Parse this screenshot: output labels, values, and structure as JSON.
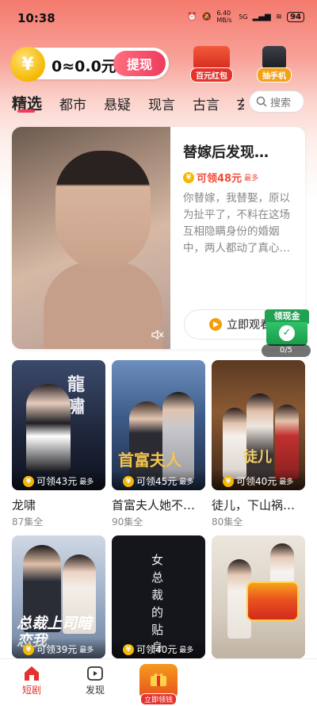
{
  "status": {
    "time": "10:38",
    "network": "6.40 MB/s",
    "signal": "5G",
    "battery": "94"
  },
  "wallet": {
    "coin_symbol": "¥",
    "amount": "0≈0.0元",
    "withdraw_label": "提现"
  },
  "promos": [
    {
      "label": "百元红包"
    },
    {
      "label": "抽手机"
    }
  ],
  "tabs": [
    "精选",
    "都市",
    "悬疑",
    "现言",
    "古言",
    "玄"
  ],
  "search": {
    "placeholder": "搜索"
  },
  "featured": {
    "title": "替嫁后发现…",
    "reward": "可领48元",
    "reward_max": "最多",
    "description": "你替嫁，我替娶，原以为扯平了，不料在这场互相隐瞒身份的婚姻中，两人都动了真心…",
    "watch_label": "立即观看"
  },
  "cash_widget": {
    "title": "领现金",
    "progress": "0/5"
  },
  "cards": [
    {
      "title": "龙啸",
      "episodes": "87集全",
      "reward": "可领43元",
      "reward_max": "最多",
      "overlay": "龍嘯"
    },
    {
      "title": "首富夫人她不…",
      "episodes": "90集全",
      "reward": "可领45元",
      "reward_max": "最多",
      "overlay": "首富夫人"
    },
    {
      "title": "徒儿，下山祸…",
      "episodes": "80集全",
      "reward": "可领40元",
      "reward_max": "最多",
      "overlay": "徒儿"
    },
    {
      "title": "",
      "episodes": "",
      "reward": "可领39元",
      "reward_max": "最多",
      "overlay": "总裁上司暗恋我"
    },
    {
      "title": "",
      "episodes": "",
      "reward": "可领40元",
      "reward_max": "最多",
      "overlay": "女总裁的贴身"
    },
    {
      "title": "",
      "episodes": "",
      "reward": "",
      "reward_max": "",
      "overlay": ""
    }
  ],
  "bottom_nav": [
    {
      "label": "短剧",
      "icon": "home-icon"
    },
    {
      "label": "发现",
      "icon": "play-icon"
    },
    {
      "label": "立即领钱",
      "icon": "gift-icon"
    }
  ],
  "colors": {
    "accent": "#ef3b5e",
    "reward": "#f24b38",
    "nav_active": "#e5322e"
  }
}
